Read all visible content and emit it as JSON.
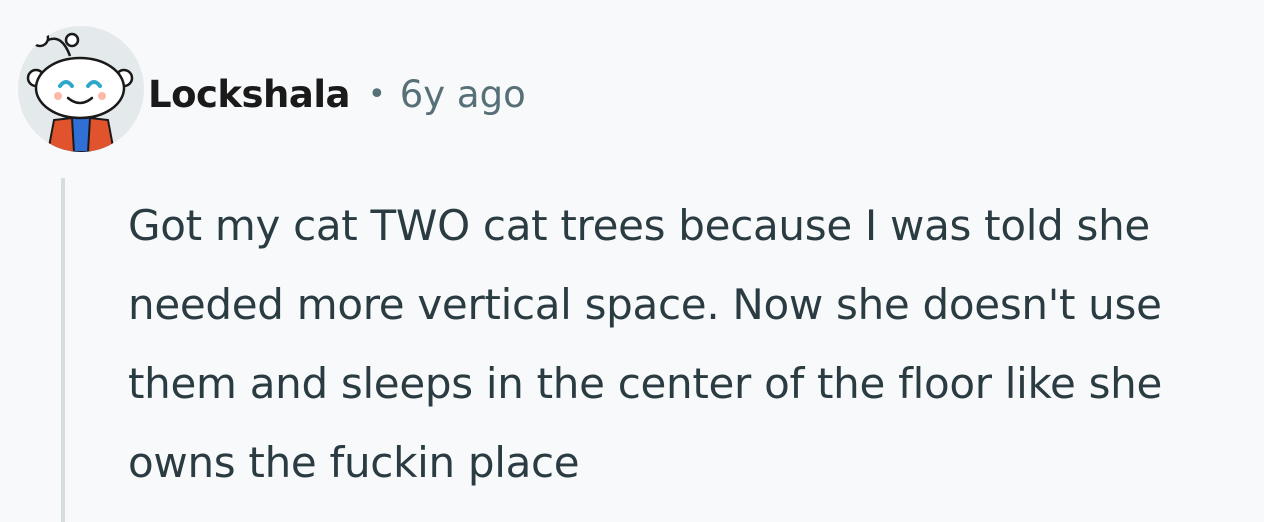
{
  "comment": {
    "author": "Lockshala",
    "separator": "•",
    "age": "6y ago",
    "body": "Got my cat TWO cat trees because I was told she needed more vertical space. Now she doesn't use them and sleeps in the center of the floor like she owns the fuckin place",
    "avatar_icon": "snoo-avatar-icon"
  },
  "colors": {
    "background": "#f7f9fa",
    "username": "#1a1a1b",
    "meta": "#576f76",
    "body_text": "#2a3c42",
    "thread_line": "#d6dde1",
    "avatar_bg": "#e4e9ec",
    "avatar_jacket": "#e0532c",
    "avatar_shirt": "#2f6fd6"
  }
}
